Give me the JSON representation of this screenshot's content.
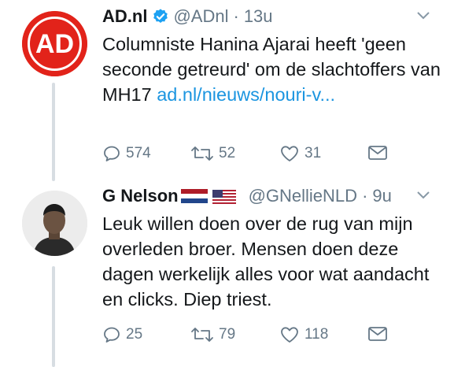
{
  "tweets": [
    {
      "name": "AD.nl",
      "handle": "@ADnl",
      "separator": "·",
      "time": "13u",
      "verified": true,
      "text": "Columniste Hanina Ajarai heeft 'geen seconde getreurd' om de slachtoffers van MH17 ",
      "link": "ad.nl/nieuws/nouri-v...",
      "avatar_text": "AD",
      "replies": "574",
      "retweets": "52",
      "likes": "31"
    },
    {
      "name": "G Nelson",
      "handle": "@GNellieNLD",
      "separator": "·",
      "time": "9u",
      "flags": [
        "dutch-flag",
        "us-flag"
      ],
      "text": "Leuk willen doen over de rug van mijn overleden broer. Mensen doen deze dagen werkelijk alles voor wat aandacht en clicks. Diep triest.",
      "replies": "25",
      "retweets": "79",
      "likes": "118"
    }
  ],
  "colors": {
    "ad_red": "#e2231a",
    "link": "#1b95e0",
    "muted": "#657786",
    "verified": "#1da1f2"
  }
}
